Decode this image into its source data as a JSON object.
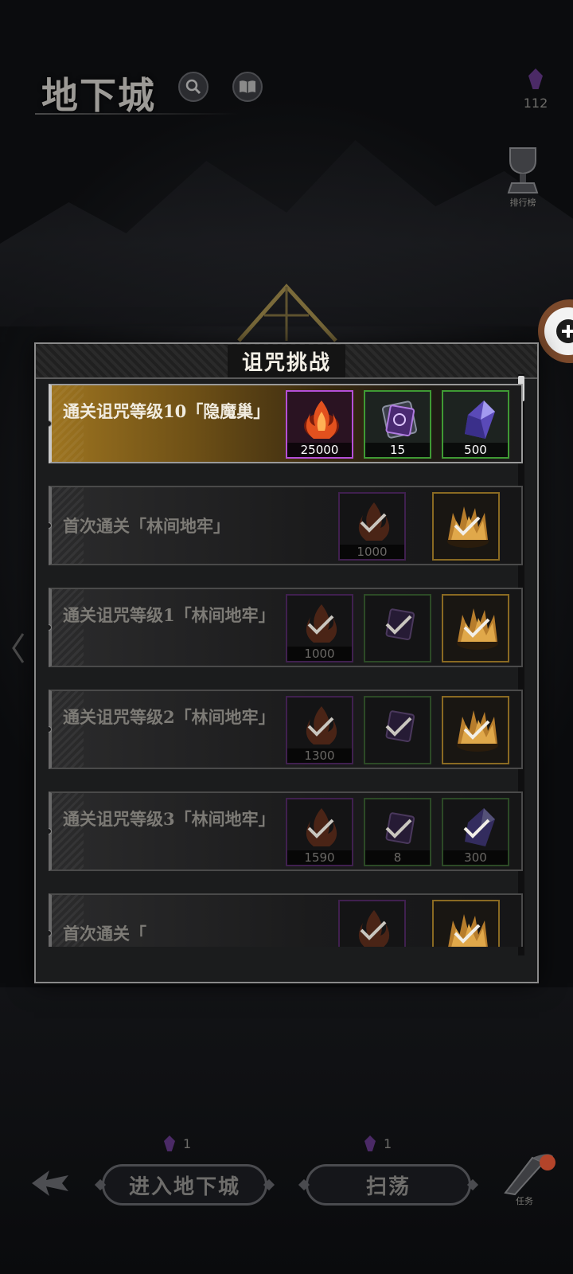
{
  "header": {
    "title": "地下城",
    "currency_value": "112",
    "rank_label": "排行榜"
  },
  "modal": {
    "title": "诅咒挑战",
    "rows": [
      {
        "text": "通关诅咒等级10「隐魔巢」",
        "state": "active",
        "rewards": [
          {
            "icon": "flame-essence-icon",
            "count": "25000",
            "rarity": "purple",
            "claimed": false
          },
          {
            "icon": "rune-stone-icon",
            "count": "15",
            "rarity": "green",
            "claimed": false
          },
          {
            "icon": "crystal-icon",
            "count": "500",
            "rarity": "green",
            "claimed": false
          }
        ]
      },
      {
        "text": "首次通关「林间地牢」",
        "state": "claimed",
        "rewards": [
          {
            "icon": "flame-essence-icon",
            "count": "1000",
            "rarity": "purple",
            "claimed": true
          },
          {
            "icon": "golden-crown-icon",
            "count": "",
            "rarity": "gold",
            "claimed": true
          }
        ]
      },
      {
        "text": "通关诅咒等级1「林间地牢」",
        "state": "claimed",
        "rewards": [
          {
            "icon": "flame-essence-icon",
            "count": "1000",
            "rarity": "purple",
            "claimed": true
          },
          {
            "icon": "rune-stone-icon",
            "count": "",
            "rarity": "green",
            "claimed": true
          },
          {
            "icon": "golden-crown-icon",
            "count": "",
            "rarity": "gold",
            "claimed": true
          }
        ]
      },
      {
        "text": "通关诅咒等级2「林间地牢」",
        "state": "claimed",
        "rewards": [
          {
            "icon": "flame-essence-icon",
            "count": "1300",
            "rarity": "purple",
            "claimed": true
          },
          {
            "icon": "rune-stone-icon",
            "count": "",
            "rarity": "green",
            "claimed": true
          },
          {
            "icon": "golden-crown-icon",
            "count": "",
            "rarity": "gold",
            "claimed": true
          }
        ]
      },
      {
        "text": "通关诅咒等级3「林间地牢」",
        "state": "claimed",
        "rewards": [
          {
            "icon": "flame-essence-icon",
            "count": "1590",
            "rarity": "purple",
            "claimed": true
          },
          {
            "icon": "rune-stone-icon",
            "count": "8",
            "rarity": "green",
            "claimed": true
          },
          {
            "icon": "crystal-icon",
            "count": "300",
            "rarity": "green",
            "claimed": true
          }
        ]
      },
      {
        "text": "首次通关「",
        "state": "claimed",
        "rewards": [
          {
            "icon": "flame-essence-icon",
            "count": "",
            "rarity": "purple",
            "claimed": true
          },
          {
            "icon": "golden-crown-icon",
            "count": "",
            "rarity": "gold",
            "claimed": true
          }
        ]
      }
    ]
  },
  "bottom": {
    "enter_label": "进入地下城",
    "enter_cost": "1",
    "sweep_label": "扫荡",
    "sweep_cost": "1",
    "task_label": "任务"
  },
  "colors": {
    "active_gold": "#9d7420",
    "purple_rarity": "#b54fd7",
    "green_rarity": "#3f9a34",
    "gold_rarity": "#8a6a22"
  }
}
